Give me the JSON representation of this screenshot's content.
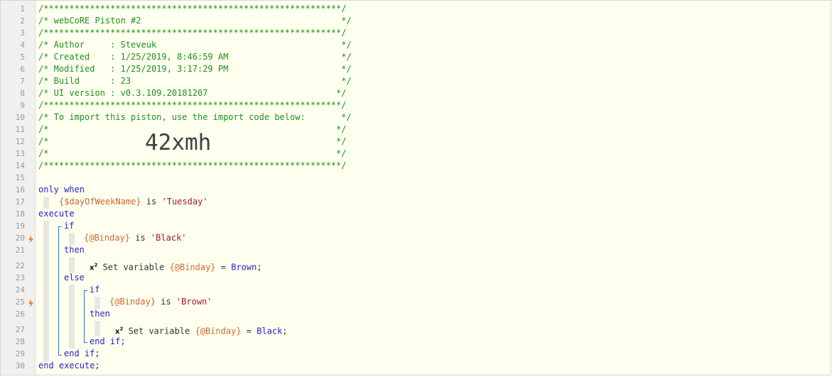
{
  "line_numbers": [
    "1",
    "2",
    "3",
    "4",
    "5",
    "6",
    "7",
    "8",
    "9",
    "10",
    "11",
    "12",
    "13",
    "14",
    "15",
    "16",
    "17",
    "18",
    "19",
    "20",
    "21",
    "22",
    "23",
    "24",
    "25",
    "26",
    "27",
    "28",
    "29",
    "30"
  ],
  "header": {
    "border": "/**********************************************************/",
    "title": "/* webCoRE Piston #2                                       */",
    "author": "/* Author     : Steveuk                                    */",
    "created": "/* Created    : 1/25/2019, 8:46:59 AM                      */",
    "modified": "/* Modified   : 1/25/2019, 3:17:29 PM                      */",
    "build": "/* Build      : 23                                         */",
    "ui_version": "/* UI version : v0.3.109.20181207                         */",
    "import_text": "/* To import this piston, use the import code below:       */",
    "blank": "/*                                                        */",
    "import_code": "42xmh"
  },
  "code": {
    "only": "only",
    "when": "when",
    "day_var": "{$dayOfWeekName}",
    "is": "is",
    "tuesday": "'Tuesday'",
    "execute": "execute",
    "if": "if",
    "binday": "{@Binday}",
    "black_str": "'Black'",
    "brown_str": "'Brown'",
    "then": "then",
    "else": "else",
    "set_variable": "Set variable",
    "equals": "=",
    "brown_val": "Brown",
    "black_val": "Black",
    "semicolon": ";",
    "end_if": "end if;",
    "end_execute": "end execute;",
    "x2": "x",
    "x2_sup": "2"
  },
  "colors": {
    "comment": "#1f8f1f",
    "keyword": "#2525c8",
    "variable": "#c86a30",
    "string": "#a11a1a",
    "bolt": "#e8822a",
    "block_line": "#2b78c2"
  }
}
